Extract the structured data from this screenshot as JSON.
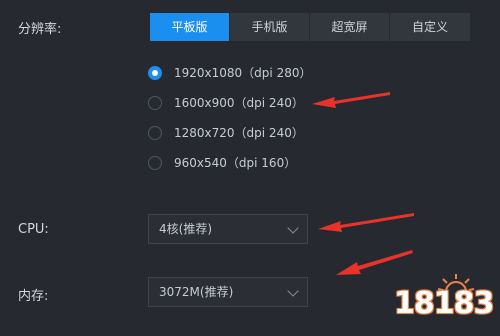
{
  "resolution": {
    "label": "分辨率:",
    "tabs": [
      {
        "label": "平板版",
        "active": true
      },
      {
        "label": "手机版",
        "active": false
      },
      {
        "label": "超宽屏",
        "active": false
      },
      {
        "label": "自定义",
        "active": false
      }
    ],
    "options": [
      {
        "label": "1920x1080（dpi 280）",
        "selected": true
      },
      {
        "label": "1600x900（dpi 240）",
        "selected": false
      },
      {
        "label": "1280x720（dpi 240）",
        "selected": false
      },
      {
        "label": "960x540（dpi 160）",
        "selected": false
      }
    ]
  },
  "cpu": {
    "label": "CPU:",
    "value": "4核(推荐)"
  },
  "memory": {
    "label": "内存:",
    "value": "3072M(推荐)"
  },
  "watermark": {
    "text": "18183"
  },
  "colors": {
    "accent": "#1a8ff0",
    "annotation": "#e8322a",
    "background": "#262a30"
  }
}
